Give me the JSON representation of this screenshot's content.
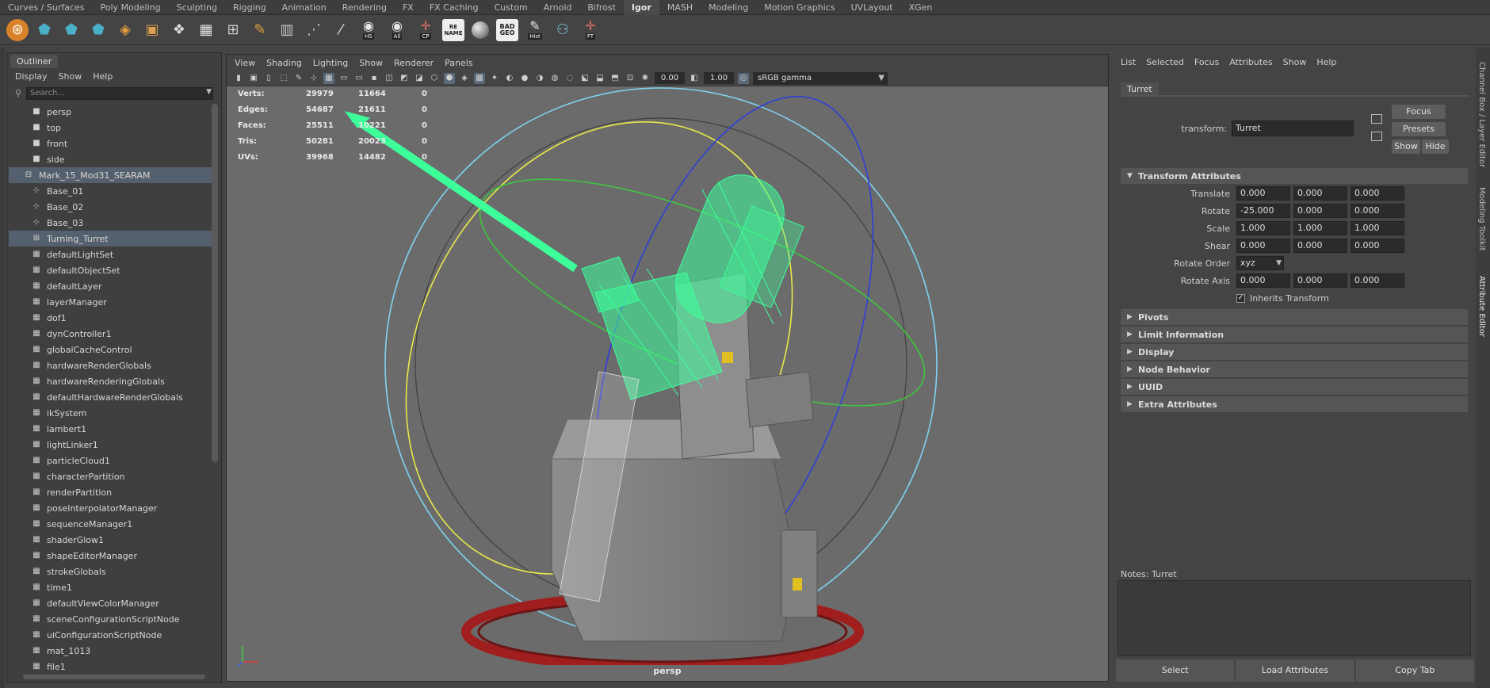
{
  "shelf_tabs": [
    "Curves / Surfaces",
    "Poly Modeling",
    "Sculpting",
    "Rigging",
    "Animation",
    "Rendering",
    "FX",
    "FX Caching",
    "Custom",
    "Arnold",
    "Bifrost",
    "Igor",
    "MASH",
    "Modeling",
    "Motion Graphics",
    "UVLayout",
    "XGen"
  ],
  "active_shelf_tab": "Igor",
  "shelf_icon_labels": {
    "hs": "HS",
    "all": "All",
    "cp": "CP",
    "rename": "RE NAME",
    "badgeo": "BAD GEO",
    "hist": "Hist",
    "ft": "FT"
  },
  "outliner": {
    "tab": "Outliner",
    "menu": [
      "Display",
      "Show",
      "Help"
    ],
    "search_placeholder": "Search...",
    "items": [
      {
        "label": "persp"
      },
      {
        "label": "top"
      },
      {
        "label": "front"
      },
      {
        "label": "side"
      },
      {
        "label": "Mark_15_Mod31_SEARAM"
      },
      {
        "label": "Base_01"
      },
      {
        "label": "Base_02"
      },
      {
        "label": "Base_03"
      },
      {
        "label": "Turning_Turret"
      },
      {
        "label": "defaultLightSet"
      },
      {
        "label": "defaultObjectSet"
      },
      {
        "label": "defaultLayer"
      },
      {
        "label": "layerManager"
      },
      {
        "label": "dof1"
      },
      {
        "label": "dynController1"
      },
      {
        "label": "globalCacheControl"
      },
      {
        "label": "hardwareRenderGlobals"
      },
      {
        "label": "hardwareRenderingGlobals"
      },
      {
        "label": "defaultHardwareRenderGlobals"
      },
      {
        "label": "ikSystem"
      },
      {
        "label": "lambert1"
      },
      {
        "label": "lightLinker1"
      },
      {
        "label": "particleCloud1"
      },
      {
        "label": "characterPartition"
      },
      {
        "label": "renderPartition"
      },
      {
        "label": "poseInterpolatorManager"
      },
      {
        "label": "sequenceManager1"
      },
      {
        "label": "shaderGlow1"
      },
      {
        "label": "shapeEditorManager"
      },
      {
        "label": "strokeGlobals"
      },
      {
        "label": "time1"
      },
      {
        "label": "defaultViewColorManager"
      },
      {
        "label": "sceneConfigurationScriptNode"
      },
      {
        "label": "uiConfigurationScriptNode"
      },
      {
        "label": "mat_1013"
      },
      {
        "label": "file1"
      }
    ]
  },
  "viewport": {
    "menu": [
      "View",
      "Shading",
      "Lighting",
      "Show",
      "Renderer",
      "Panels"
    ],
    "exposure": "0.00",
    "gamma": "1.00",
    "color_space": "sRGB gamma",
    "camera": "persp",
    "hud": [
      {
        "k": "Verts:",
        "a": "29979",
        "b": "11664",
        "c": "0"
      },
      {
        "k": "Edges:",
        "a": "54687",
        "b": "21611",
        "c": "0"
      },
      {
        "k": "Faces:",
        "a": "25511",
        "b": "10221",
        "c": "0"
      },
      {
        "k": "Tris:",
        "a": "50281",
        "b": "20023",
        "c": "0"
      },
      {
        "k": "UVs:",
        "a": "39968",
        "b": "14482",
        "c": "0"
      }
    ]
  },
  "attribute_editor": {
    "menu": [
      "List",
      "Selected",
      "Focus",
      "Attributes",
      "Show",
      "Help"
    ],
    "node_tab": "Turret",
    "transform_label": "transform:",
    "transform_value": "Turret",
    "buttons": {
      "focus": "Focus",
      "presets": "Presets",
      "show": "Show",
      "hide": "Hide"
    },
    "transform_section": "Transform Attributes",
    "rows": {
      "translate": {
        "label": "Translate",
        "x": "0.000",
        "y": "0.000",
        "z": "0.000"
      },
      "rotate": {
        "label": "Rotate",
        "x": "-25.000",
        "y": "0.000",
        "z": "0.000"
      },
      "scale": {
        "label": "Scale",
        "x": "1.000",
        "y": "1.000",
        "z": "1.000"
      },
      "shear": {
        "label": "Shear",
        "x": "0.000",
        "y": "0.000",
        "z": "0.000"
      },
      "rotate_order": {
        "label": "Rotate Order",
        "value": "xyz"
      },
      "rotate_axis": {
        "label": "Rotate Axis",
        "x": "0.000",
        "y": "0.000",
        "z": "0.000"
      }
    },
    "inherits_transform": "Inherits Transform",
    "sections": [
      "Pivots",
      "Limit Information",
      "Display",
      "Node Behavior",
      "UUID",
      "Extra Attributes"
    ],
    "notes_label": "Notes:  Turret",
    "bottom_buttons": [
      "Select",
      "Load Attributes",
      "Copy Tab"
    ]
  },
  "side_tabs": [
    "Channel Box / Layer Editor",
    "Modeling Toolkit",
    "Attribute Editor"
  ]
}
